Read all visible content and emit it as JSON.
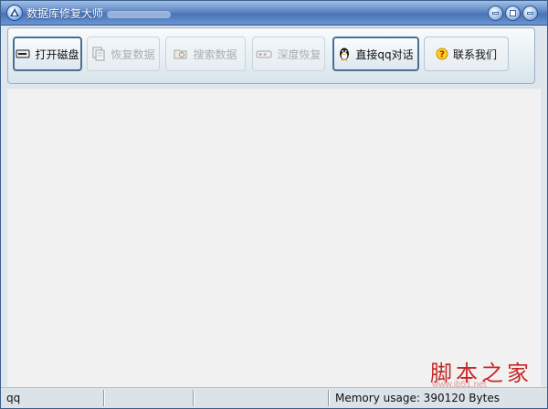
{
  "window": {
    "title": "数据库修复大师"
  },
  "toolbar": {
    "buttons": [
      {
        "label": "打开磁盘",
        "icon": "disk-drive-icon",
        "enabled": true
      },
      {
        "label": "恢复数据",
        "icon": "documents-icon",
        "enabled": false
      },
      {
        "label": "搜索数据",
        "icon": "search-folder-icon",
        "enabled": false
      },
      {
        "label": "深度恢复",
        "icon": "deep-recovery-icon",
        "enabled": false
      },
      {
        "label": "直接qq对话",
        "icon": "qq-penguin-icon",
        "enabled": true
      },
      {
        "label": "联系我们",
        "icon": "help-question-icon",
        "enabled": true
      }
    ]
  },
  "statusbar": {
    "left": "qq",
    "memory": "Memory usage: 390120 Bytes"
  },
  "watermark": {
    "brand": "脚本之家",
    "url": "www.jb51.net"
  },
  "colors": {
    "title_bar": "#4a74b6",
    "client_bg": "#f1f1f1",
    "watermark": "#c62828"
  }
}
